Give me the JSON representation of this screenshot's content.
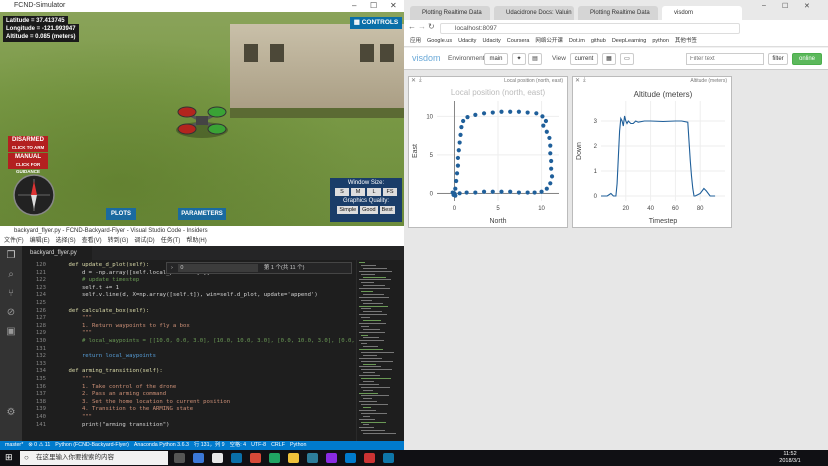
{
  "simulator": {
    "window_title": "FCND-Simulator",
    "latitude": "Latitude = 37.413745",
    "longitude": "Longitude = -121.993947",
    "altitude": "Altitude = 0.085 (meters)",
    "controls_label": "CONTROLS",
    "disarmed_label": "DISARMED",
    "disarmed_sub": "CLICK TO ARM",
    "manual_label": "MANUAL",
    "manual_sub": "CLICK FOR GUIDANCE",
    "plots_label": "PLOTS",
    "parameters_label": "PARAMETERS",
    "window_size_label": "Window Size:",
    "size_options": [
      "S",
      "M",
      "L",
      "FS"
    ],
    "graphics_quality_label": "Graphics Quality:",
    "quality_options": [
      "Simple",
      "Good",
      "Best"
    ]
  },
  "vscode": {
    "window_title": "backyard_flyer.py - FCND-Backyard-Flyer - Visual Studio Code - Insiders",
    "menu": [
      "文件(F)",
      "编辑(E)",
      "选择(S)",
      "查看(V)",
      "转到(G)",
      "调试(D)",
      "任务(T)",
      "帮助(H)"
    ],
    "tab": "backyard_flyer.py",
    "find_text": "第 1 个(共 11 个)",
    "find_input": "0",
    "lines": [
      {
        "n": "120",
        "text": "    def update_d_plot(self):"
      },
      {
        "n": "121",
        "text": "        d = -np.array([self.local_position[1]]"
      },
      {
        "n": "122",
        "text": "        # update timestep"
      },
      {
        "n": "123",
        "text": "        self.t += 1"
      },
      {
        "n": "124",
        "text": "        self.v.line(d, X=np.array([self.t]), win=self.d_plot, update='append')"
      },
      {
        "n": "125",
        "text": ""
      },
      {
        "n": "126",
        "text": "    def calculate_box(self):"
      },
      {
        "n": "127",
        "text": "        \"\"\""
      },
      {
        "n": "128",
        "text": "        1. Return waypoints to fly a box"
      },
      {
        "n": "129",
        "text": "        \"\"\""
      },
      {
        "n": "130",
        "text": "        # local_waypoints = [[10.0, 0.0, 3.0], [10.0, 10.0, 3.0], [0.0, 10.0, 3.0], [0.0, 0.0, 3.0]]"
      },
      {
        "n": "131",
        "text": ""
      },
      {
        "n": "132",
        "text": "        return local_waypoints"
      },
      {
        "n": "133",
        "text": ""
      },
      {
        "n": "134",
        "text": "    def arming_transition(self):"
      },
      {
        "n": "135",
        "text": "        \"\"\""
      },
      {
        "n": "136",
        "text": "        1. Take control of the drone"
      },
      {
        "n": "137",
        "text": "        2. Pass an arming command"
      },
      {
        "n": "138",
        "text": "        3. Set the home location to current position"
      },
      {
        "n": "139",
        "text": "        4. Transition to the ARMING state"
      },
      {
        "n": "140",
        "text": "        \"\"\""
      },
      {
        "n": "141",
        "text": "        print(\"arming transition\")"
      }
    ],
    "status_items": [
      "master*",
      "⊗ 0  ⚠ 11",
      "Python (FCND-Backyard-Flyer)",
      "Anaconda Python 3.6.3",
      "行 131，列 9",
      "空格: 4",
      "UTF-8",
      "CRLF",
      "Python"
    ]
  },
  "chrome": {
    "tabs": [
      "Plotting Realtime Data",
      "Udacidrone Docs: Valuin",
      "Plotting Realtime Data",
      "visdom"
    ],
    "url": "localhost:8097",
    "bookmarks": [
      "应用",
      "Google.us",
      "Udacity",
      "Udacity",
      "Coursera",
      "网络公开课",
      "Dot.im",
      "github",
      "DeepLearning",
      "python",
      "其他书签"
    ],
    "visdom": {
      "logo": "visdom",
      "environment_label": "Environment",
      "environment_value": "main",
      "view_label": "View",
      "view_value": "current",
      "filter_placeholder": "Filter text",
      "filter_button": "filter",
      "online_label": "online"
    }
  },
  "panes": {
    "local_position": {
      "pane_title": "Local position (north, east)",
      "overlay_title": "Local position (north, east)"
    },
    "altitude": {
      "pane_title": "Altitude (meters)",
      "title": "Altitude (meters)"
    }
  },
  "chart_data": [
    {
      "type": "scatter",
      "title": "Local position (north, east)",
      "xlabel": "North",
      "ylabel": "East",
      "xlim": [
        -2,
        12
      ],
      "ylim": [
        -1,
        12
      ],
      "xticks": [
        0,
        5,
        10
      ],
      "yticks": [
        0,
        5,
        10
      ],
      "marker_color": "#1f5f9a",
      "points": [
        [
          0,
          0
        ],
        [
          0.1,
          0.6
        ],
        [
          0.2,
          1.6
        ],
        [
          0.3,
          2.6
        ],
        [
          0.4,
          3.6
        ],
        [
          0.4,
          4.6
        ],
        [
          0.5,
          5.6
        ],
        [
          0.6,
          6.6
        ],
        [
          0.7,
          7.6
        ],
        [
          0.8,
          8.6
        ],
        [
          1,
          9.4
        ],
        [
          1.5,
          9.9
        ],
        [
          2.4,
          10.2
        ],
        [
          3.4,
          10.4
        ],
        [
          4.4,
          10.5
        ],
        [
          5.4,
          10.6
        ],
        [
          6.4,
          10.6
        ],
        [
          7.4,
          10.6
        ],
        [
          8.4,
          10.5
        ],
        [
          9.4,
          10.4
        ],
        [
          10.1,
          10.0
        ],
        [
          10.5,
          9.4
        ],
        [
          10.2,
          8.8
        ],
        [
          10.6,
          8.0
        ],
        [
          10.9,
          7.2
        ],
        [
          11.0,
          6.2
        ],
        [
          11.0,
          5.2
        ],
        [
          11.1,
          4.2
        ],
        [
          11.1,
          3.2
        ],
        [
          11.2,
          2.2
        ],
        [
          11.0,
          1.3
        ],
        [
          10.6,
          0.6
        ],
        [
          10.0,
          0.2
        ],
        [
          9.2,
          0.1
        ],
        [
          8.4,
          0.1
        ],
        [
          7.4,
          0.1
        ],
        [
          6.4,
          0.2
        ],
        [
          5.4,
          0.2
        ],
        [
          4.4,
          0.2
        ],
        [
          3.4,
          0.2
        ],
        [
          2.4,
          0.1
        ],
        [
          1.4,
          0.1
        ],
        [
          0.6,
          0
        ],
        [
          -0.1,
          -0.2
        ],
        [
          0.1,
          -0.3
        ],
        [
          -0.2,
          0.1
        ]
      ]
    },
    {
      "type": "line",
      "title": "Altitude (meters)",
      "xlabel": "Timestep",
      "ylabel": "Down",
      "xlim": [
        0,
        100
      ],
      "ylim": [
        -0.2,
        3.8
      ],
      "xticks": [
        20,
        40,
        60,
        80
      ],
      "yticks": [
        0,
        1,
        2,
        3
      ],
      "line_color": "#1f5f9a",
      "x": [
        0,
        5,
        8,
        10,
        12,
        13,
        14,
        15,
        16,
        17,
        18,
        19,
        20,
        21,
        22,
        24,
        26,
        28,
        30,
        35,
        40,
        50,
        60,
        65,
        70,
        71,
        72,
        73,
        74,
        75,
        76,
        78,
        80,
        83,
        85,
        88,
        90,
        92
      ],
      "y": [
        0,
        0,
        0.1,
        0,
        0,
        0.5,
        1.6,
        2.6,
        3.1,
        3.0,
        2.8,
        3.2,
        3.0,
        2.9,
        3.0,
        2.9,
        2.9,
        3.0,
        2.95,
        3.0,
        3.0,
        2.98,
        3.0,
        3.0,
        2.95,
        2.2,
        1.4,
        0.8,
        0.3,
        0,
        0,
        0.05,
        0.1,
        0.3,
        0.2,
        0,
        0,
        0
      ]
    }
  ],
  "taskbar": {
    "search_placeholder": "在这里输入你要搜索的内容",
    "time": "11:52",
    "date": "2018/3/1"
  }
}
